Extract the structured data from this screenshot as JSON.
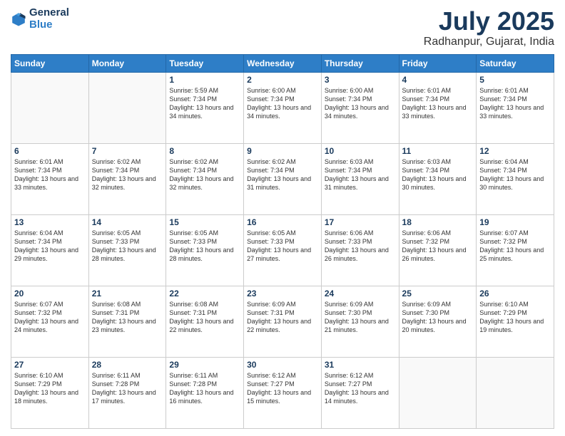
{
  "header": {
    "logo_line1": "General",
    "logo_line2": "Blue",
    "month": "July 2025",
    "location": "Radhanpur, Gujarat, India"
  },
  "days_of_week": [
    "Sunday",
    "Monday",
    "Tuesday",
    "Wednesday",
    "Thursday",
    "Friday",
    "Saturday"
  ],
  "weeks": [
    [
      {
        "day": "",
        "text": ""
      },
      {
        "day": "",
        "text": ""
      },
      {
        "day": "1",
        "text": "Sunrise: 5:59 AM\nSunset: 7:34 PM\nDaylight: 13 hours and 34 minutes."
      },
      {
        "day": "2",
        "text": "Sunrise: 6:00 AM\nSunset: 7:34 PM\nDaylight: 13 hours and 34 minutes."
      },
      {
        "day": "3",
        "text": "Sunrise: 6:00 AM\nSunset: 7:34 PM\nDaylight: 13 hours and 34 minutes."
      },
      {
        "day": "4",
        "text": "Sunrise: 6:01 AM\nSunset: 7:34 PM\nDaylight: 13 hours and 33 minutes."
      },
      {
        "day": "5",
        "text": "Sunrise: 6:01 AM\nSunset: 7:34 PM\nDaylight: 13 hours and 33 minutes."
      }
    ],
    [
      {
        "day": "6",
        "text": "Sunrise: 6:01 AM\nSunset: 7:34 PM\nDaylight: 13 hours and 33 minutes."
      },
      {
        "day": "7",
        "text": "Sunrise: 6:02 AM\nSunset: 7:34 PM\nDaylight: 13 hours and 32 minutes."
      },
      {
        "day": "8",
        "text": "Sunrise: 6:02 AM\nSunset: 7:34 PM\nDaylight: 13 hours and 32 minutes."
      },
      {
        "day": "9",
        "text": "Sunrise: 6:02 AM\nSunset: 7:34 PM\nDaylight: 13 hours and 31 minutes."
      },
      {
        "day": "10",
        "text": "Sunrise: 6:03 AM\nSunset: 7:34 PM\nDaylight: 13 hours and 31 minutes."
      },
      {
        "day": "11",
        "text": "Sunrise: 6:03 AM\nSunset: 7:34 PM\nDaylight: 13 hours and 30 minutes."
      },
      {
        "day": "12",
        "text": "Sunrise: 6:04 AM\nSunset: 7:34 PM\nDaylight: 13 hours and 30 minutes."
      }
    ],
    [
      {
        "day": "13",
        "text": "Sunrise: 6:04 AM\nSunset: 7:34 PM\nDaylight: 13 hours and 29 minutes."
      },
      {
        "day": "14",
        "text": "Sunrise: 6:05 AM\nSunset: 7:33 PM\nDaylight: 13 hours and 28 minutes."
      },
      {
        "day": "15",
        "text": "Sunrise: 6:05 AM\nSunset: 7:33 PM\nDaylight: 13 hours and 28 minutes."
      },
      {
        "day": "16",
        "text": "Sunrise: 6:05 AM\nSunset: 7:33 PM\nDaylight: 13 hours and 27 minutes."
      },
      {
        "day": "17",
        "text": "Sunrise: 6:06 AM\nSunset: 7:33 PM\nDaylight: 13 hours and 26 minutes."
      },
      {
        "day": "18",
        "text": "Sunrise: 6:06 AM\nSunset: 7:32 PM\nDaylight: 13 hours and 26 minutes."
      },
      {
        "day": "19",
        "text": "Sunrise: 6:07 AM\nSunset: 7:32 PM\nDaylight: 13 hours and 25 minutes."
      }
    ],
    [
      {
        "day": "20",
        "text": "Sunrise: 6:07 AM\nSunset: 7:32 PM\nDaylight: 13 hours and 24 minutes."
      },
      {
        "day": "21",
        "text": "Sunrise: 6:08 AM\nSunset: 7:31 PM\nDaylight: 13 hours and 23 minutes."
      },
      {
        "day": "22",
        "text": "Sunrise: 6:08 AM\nSunset: 7:31 PM\nDaylight: 13 hours and 22 minutes."
      },
      {
        "day": "23",
        "text": "Sunrise: 6:09 AM\nSunset: 7:31 PM\nDaylight: 13 hours and 22 minutes."
      },
      {
        "day": "24",
        "text": "Sunrise: 6:09 AM\nSunset: 7:30 PM\nDaylight: 13 hours and 21 minutes."
      },
      {
        "day": "25",
        "text": "Sunrise: 6:09 AM\nSunset: 7:30 PM\nDaylight: 13 hours and 20 minutes."
      },
      {
        "day": "26",
        "text": "Sunrise: 6:10 AM\nSunset: 7:29 PM\nDaylight: 13 hours and 19 minutes."
      }
    ],
    [
      {
        "day": "27",
        "text": "Sunrise: 6:10 AM\nSunset: 7:29 PM\nDaylight: 13 hours and 18 minutes."
      },
      {
        "day": "28",
        "text": "Sunrise: 6:11 AM\nSunset: 7:28 PM\nDaylight: 13 hours and 17 minutes."
      },
      {
        "day": "29",
        "text": "Sunrise: 6:11 AM\nSunset: 7:28 PM\nDaylight: 13 hours and 16 minutes."
      },
      {
        "day": "30",
        "text": "Sunrise: 6:12 AM\nSunset: 7:27 PM\nDaylight: 13 hours and 15 minutes."
      },
      {
        "day": "31",
        "text": "Sunrise: 6:12 AM\nSunset: 7:27 PM\nDaylight: 13 hours and 14 minutes."
      },
      {
        "day": "",
        "text": ""
      },
      {
        "day": "",
        "text": ""
      }
    ]
  ]
}
